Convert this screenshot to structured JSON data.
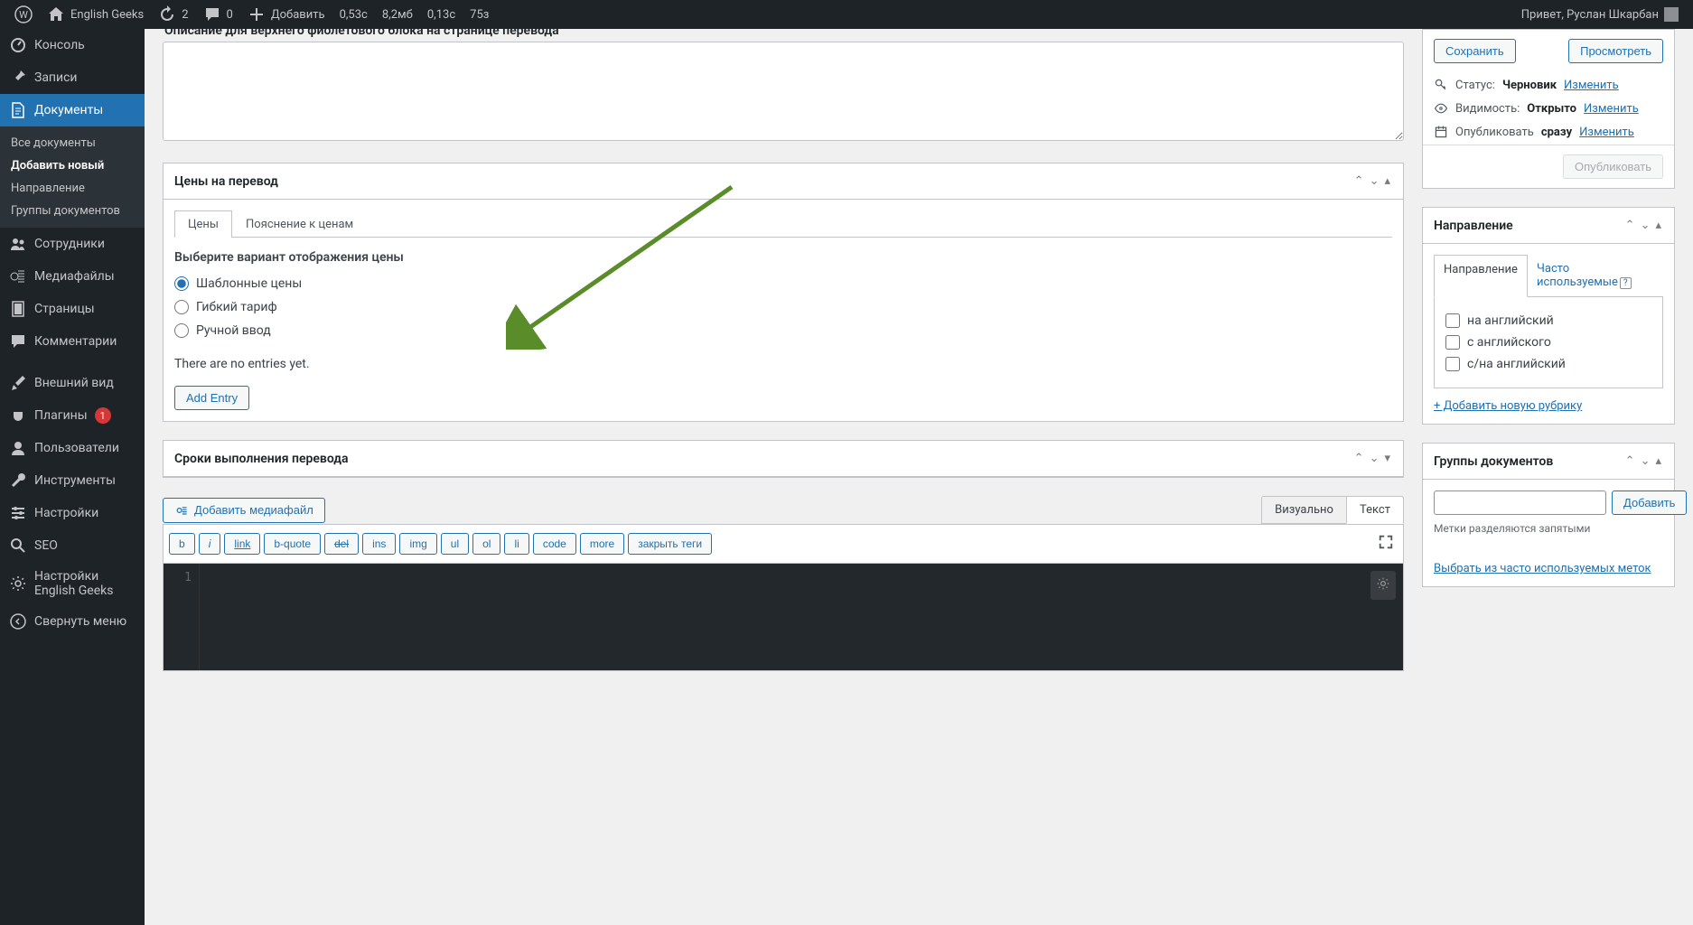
{
  "adminbar": {
    "site_name": "English Geeks",
    "updates_count": "2",
    "comments_count": "0",
    "add_new": "Добавить",
    "perf1": "0,53с",
    "perf2": "8,2мб",
    "perf3": "0,13с",
    "perf4": "75з",
    "greeting": "Привет, Руслан Шкарбан"
  },
  "sidebar": {
    "dashboard": "Консоль",
    "posts": "Записи",
    "documents": "Документы",
    "sub_all_docs": "Все документы",
    "sub_add_new": "Добавить новый",
    "sub_direction": "Направление",
    "sub_groups": "Группы документов",
    "employees": "Сотрудники",
    "media": "Медиафайлы",
    "pages": "Страницы",
    "comments": "Комментарии",
    "appearance": "Внешний вид",
    "plugins": "Плагины",
    "plugins_badge": "1",
    "users": "Пользователи",
    "tools": "Инструменты",
    "settings": "Настройки",
    "seo": "SEO",
    "eg_settings": "Настройки English Geeks",
    "collapse": "Свернуть меню"
  },
  "main": {
    "desc_label": "Описание для верхнего фиолетового блока на странице перевода",
    "prices_box_title": "Цены на перевод",
    "tab_prices": "Цены",
    "tab_explain": "Пояснение к ценам",
    "price_variant_label": "Выберите вариант отображения цены",
    "radio_template": "Шаблонные цены",
    "radio_flex": "Гибкий тариф",
    "radio_manual": "Ручной ввод",
    "no_entries": "There are no entries yet.",
    "add_entry": "Add Entry",
    "deadlines_title": "Сроки выполнения перевода",
    "add_media": "Добавить медиафайл",
    "editor_tab_visual": "Визуально",
    "editor_tab_text": "Текст",
    "qt": {
      "b": "b",
      "i": "i",
      "link": "link",
      "bquote": "b-quote",
      "del": "del",
      "ins": "ins",
      "img": "img",
      "ul": "ul",
      "ol": "ol",
      "li": "li",
      "code": "code",
      "more": "more",
      "close": "закрыть теги"
    },
    "line_no": "1"
  },
  "publish": {
    "save_btn": "Сохранить",
    "preview_btn": "Просмотреть",
    "status_label": "Статус:",
    "status_value": "Черновик",
    "visibility_label": "Видимость:",
    "visibility_value": "Открыто",
    "publish_label": "Опубликовать",
    "publish_value": "сразу",
    "edit": "Изменить",
    "publish_btn": "Опубликовать"
  },
  "direction_box": {
    "title": "Направление",
    "tab_main": "Направление",
    "tab_freq": "Часто используемые",
    "opt_to_en": "на английский",
    "opt_from_en": "с английского",
    "opt_both": "с/на английский",
    "add_new": "+ Добавить новую рубрику"
  },
  "groups_box": {
    "title": "Группы документов",
    "add_btn": "Добавить",
    "hint": "Метки разделяются запятыми",
    "choose_freq": "Выбрать из часто используемых меток"
  }
}
